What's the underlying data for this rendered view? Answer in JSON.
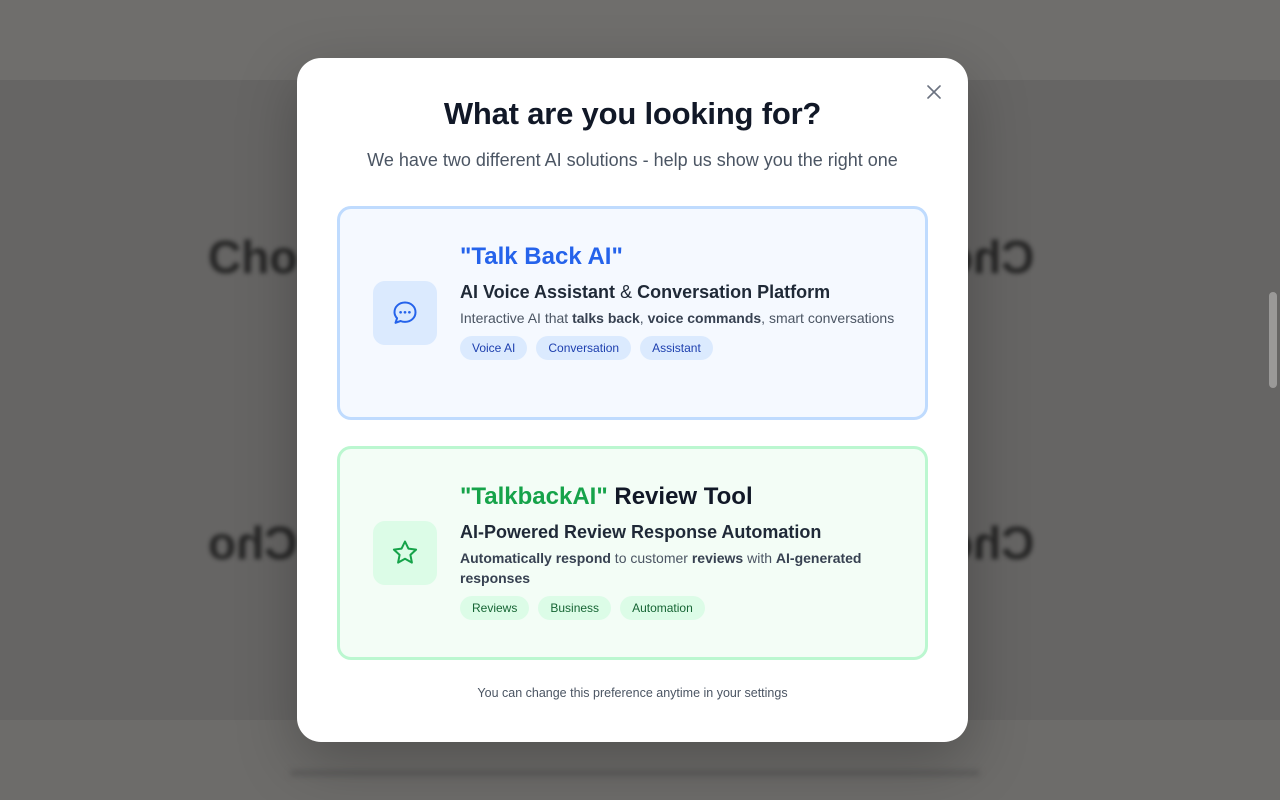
{
  "background": {
    "words": [
      "Cho",
      "Cho",
      "Cho",
      "Cho"
    ]
  },
  "modal": {
    "title": "What are you looking for?",
    "subtitle": "We have two different AI solutions - help us show you the right one",
    "close_icon": "close-icon",
    "footnote": "You can change this preference anytime in your settings"
  },
  "options": [
    {
      "icon": "chat-bubble-icon",
      "title_quoted": "\"Talk Back AI\"",
      "title_rest": "",
      "heading_part1": "AI Voice Assistant",
      "heading_amp": " & ",
      "heading_part2": "Conversation Platform",
      "desc": [
        {
          "text": "Interactive AI that ",
          "bold": false
        },
        {
          "text": "talks back",
          "bold": true
        },
        {
          "text": ", ",
          "bold": false
        },
        {
          "text": "voice commands",
          "bold": true
        },
        {
          "text": ", smart conversations",
          "bold": false
        }
      ],
      "tags": [
        "Voice AI",
        "Conversation",
        "Assistant"
      ],
      "accent": "#2563eb"
    },
    {
      "icon": "star-icon",
      "title_quoted": "\"TalkbackAI\"",
      "title_rest": " Review Tool",
      "heading_part1": "AI-Powered Review Response Automation",
      "heading_amp": "",
      "heading_part2": "",
      "desc": [
        {
          "text": "Automatically respond",
          "bold": true
        },
        {
          "text": " to customer ",
          "bold": false
        },
        {
          "text": "reviews",
          "bold": true
        },
        {
          "text": " with ",
          "bold": false
        },
        {
          "text": "AI-generated responses",
          "bold": true
        }
      ],
      "tags": [
        "Reviews",
        "Business",
        "Automation"
      ],
      "accent": "#16a34a"
    }
  ]
}
